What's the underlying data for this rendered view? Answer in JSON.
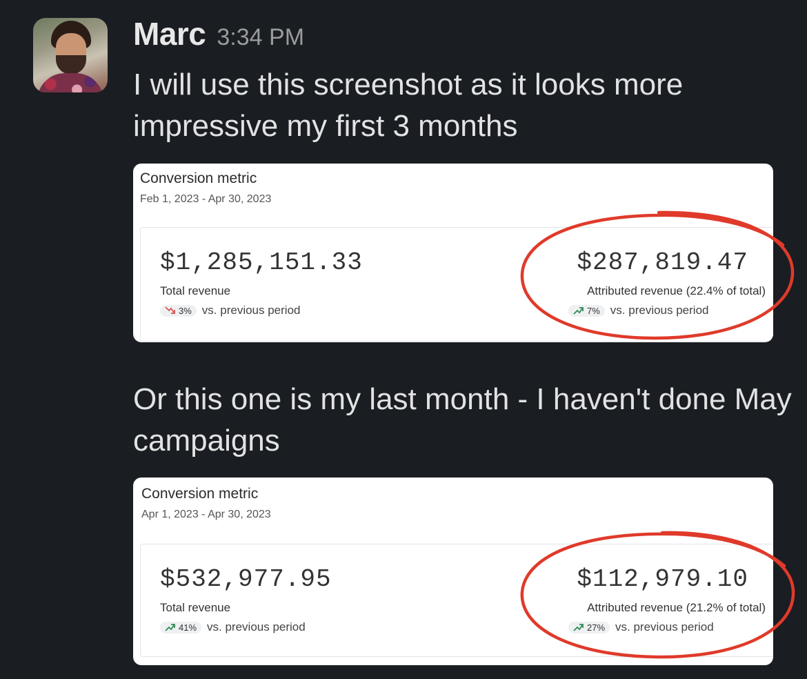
{
  "message": {
    "author": "Marc",
    "time": "3:34 PM",
    "text1": "I will use this screenshot as it looks more impressive my first 3 months",
    "text2": "Or this one is my last month - I haven't done May campaigns"
  },
  "cards": [
    {
      "title": "Conversion metric",
      "date_range": "Feb 1, 2023 - Apr 30, 2023",
      "total_amount": "$1,285,151.33",
      "total_label": "Total revenue",
      "total_change": "3%",
      "total_direction": "down",
      "attributed_amount": "$287,819.47",
      "attributed_label": "Attributed revenue (22.4% of total)",
      "attributed_change": "7%",
      "attributed_direction": "up",
      "comparison_text": "vs. previous period"
    },
    {
      "title": "Conversion metric",
      "date_range": "Apr 1, 2023 - Apr 30, 2023",
      "total_amount": "$532,977.95",
      "total_label": "Total revenue",
      "total_change": "41%",
      "total_direction": "up",
      "attributed_amount": "$112,979.10",
      "attributed_label": "Attributed revenue (21.2% of total)",
      "attributed_change": "27%",
      "attributed_direction": "up",
      "comparison_text": "vs. previous period"
    }
  ],
  "colors": {
    "background": "#1a1d21",
    "up_arrow": "#2e8b57",
    "down_arrow": "#d9534f",
    "annotation_circle": "#e03a2a"
  },
  "icons": [
    "trend-up-icon",
    "trend-down-icon"
  ]
}
